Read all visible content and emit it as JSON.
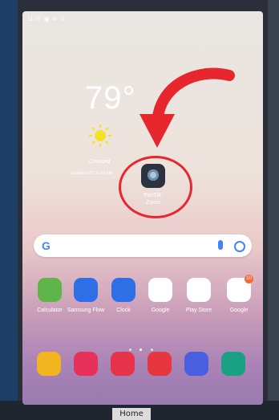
{
  "status_bar": {
    "time": "11:37",
    "icons": [
      "gallery-icon",
      "mail-icon",
      "google-icon"
    ]
  },
  "weather": {
    "temperature": "79°",
    "city": "Concord",
    "updated": "Updated 9/11 10:47 AM"
  },
  "highlighted_app": {
    "label": "PanTilt- Zoom",
    "icon": "camera-icon"
  },
  "annotation": {
    "arrow_color": "#e8262e",
    "circle_color": "#e8262e"
  },
  "search_bar": {
    "logo": "G",
    "icons": [
      "mic-icon",
      "lens-icon"
    ]
  },
  "apps": [
    {
      "label": "Calculator",
      "icon": "calculator-icon",
      "color": "#5fb54a"
    },
    {
      "label": "Samsung Flow",
      "icon": "flow-icon",
      "color": "#2f6fe6"
    },
    {
      "label": "Clock",
      "icon": "clock-icon",
      "color": "#2f6fe6"
    },
    {
      "label": "Google",
      "icon": "google-icon",
      "color": "#ffffff"
    },
    {
      "label": "Play Store",
      "icon": "play-store-icon",
      "color": "#ffffff"
    },
    {
      "label": "Google",
      "icon": "google-folder-icon",
      "color": "#ffffff",
      "badge": "10"
    }
  ],
  "dock": [
    {
      "icon": "files-icon",
      "color": "#f3b51f"
    },
    {
      "icon": "bixby-icon",
      "color": "#e7305a"
    },
    {
      "icon": "camera-icon",
      "color": "#e6334b"
    },
    {
      "icon": "email-icon",
      "color": "#e8363f"
    },
    {
      "icon": "internet-icon",
      "color": "#4a5fe0"
    },
    {
      "icon": "calendar-icon",
      "color": "#1aa083"
    }
  ],
  "hardware": {
    "home_key": "Home"
  }
}
